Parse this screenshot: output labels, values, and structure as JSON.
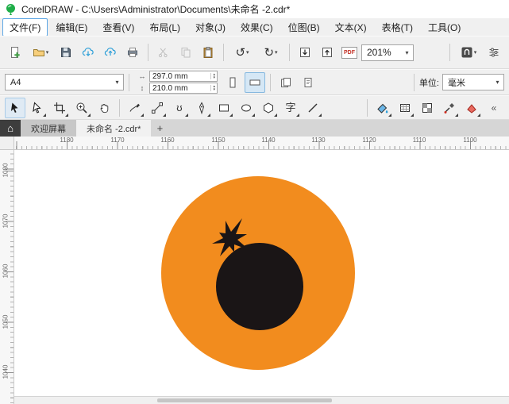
{
  "window": {
    "title": "CorelDRAW - C:\\Users\\Administrator\\Documents\\未命名 -2.cdr*"
  },
  "menus": [
    "文件(F)",
    "编辑(E)",
    "查看(V)",
    "布局(L)",
    "对象(J)",
    "效果(C)",
    "位图(B)",
    "文本(X)",
    "表格(T)",
    "工具(O)"
  ],
  "toolbar": {
    "zoom": "201%",
    "pdf": "PDF"
  },
  "propbar": {
    "page_size": "A4",
    "width": "297.0 mm",
    "height": "210.0 mm",
    "units_label": "单位:",
    "units": "毫米"
  },
  "toolbox": {
    "text_tool": "字"
  },
  "tabs": {
    "welcome": "欢迎屏幕",
    "document": "未命名 -2.cdr*",
    "add": "+"
  },
  "rulers": {
    "h": [
      "1180",
      "1170",
      "1160",
      "1150",
      "1140",
      "1130",
      "1120",
      "1110",
      "1100"
    ],
    "v": [
      "1080",
      "1070",
      "1060",
      "1050",
      "1040"
    ]
  },
  "canvas": {
    "orange": "#F28C1E",
    "black": "#1A1516"
  }
}
